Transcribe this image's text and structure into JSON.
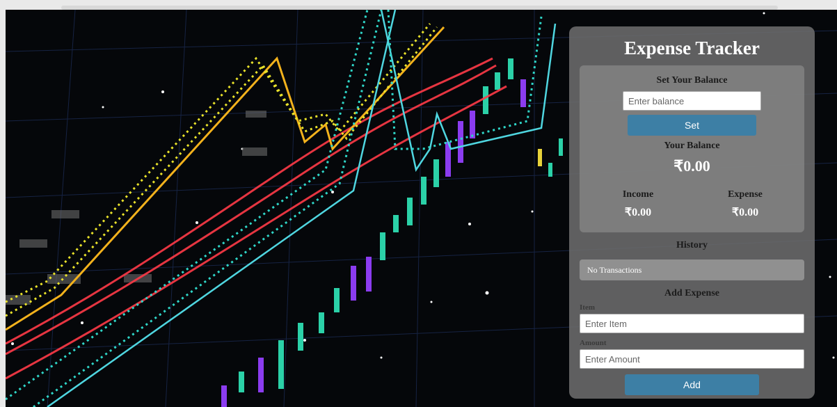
{
  "app": {
    "title": "Expense Tracker"
  },
  "balance_section": {
    "heading": "Set Your Balance",
    "input_placeholder": "Enter balance",
    "set_button": "Set",
    "your_balance_label": "Your Balance",
    "your_balance_value": "₹0.00",
    "income_label": "Income",
    "income_value": "₹0.00",
    "expense_label": "Expense",
    "expense_value": "₹0.00"
  },
  "history": {
    "heading": "History",
    "empty_text": "No Transactions"
  },
  "add_expense": {
    "heading": "Add Expense",
    "item_label": "Item",
    "item_placeholder": "Enter Item",
    "amount_label": "Amount",
    "amount_placeholder": "Enter Amount",
    "add_button": "Add"
  },
  "colors": {
    "button": "#3d7fa5",
    "panel": "#6c6c6c",
    "background": "#05070a"
  }
}
